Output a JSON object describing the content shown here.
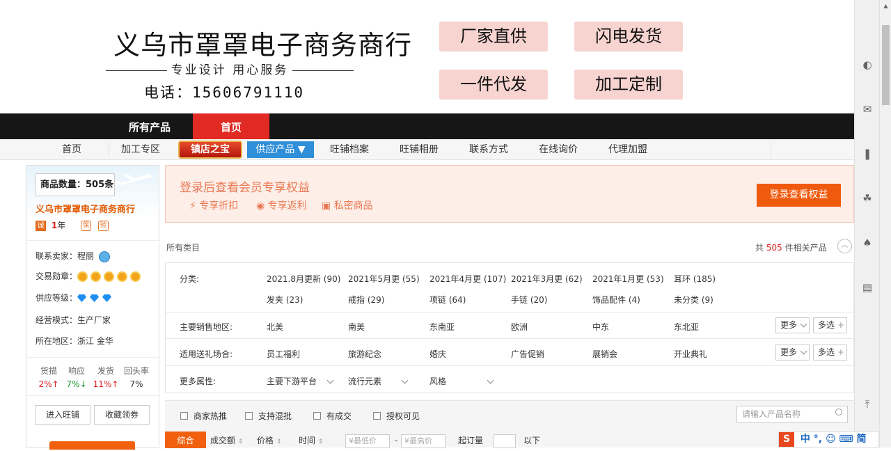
{
  "banner": {
    "shop_title": "义乌市罩罩电子商务商行",
    "slogan": "专业设计  用心服务",
    "phone": "电话：15606791110",
    "tags": [
      "厂家直供",
      "闪电发货",
      "一件代发",
      "加工定制"
    ]
  },
  "topnav": {
    "items": [
      "所有产品",
      "首页"
    ],
    "active_color": "#e02a23"
  },
  "subnav": {
    "items": [
      "首页",
      "加工专区",
      "旺铺档案",
      "旺铺相册",
      "联系方式",
      "在线询价",
      "代理加盟"
    ],
    "treasure_label": "镇店之宝",
    "supply_label": "供应产品 ▼"
  },
  "sidebar": {
    "count_label": "商品数量：505条",
    "shop_name": "义乌市罩罩电子商务商行",
    "years_num": "1",
    "years_unit": "年",
    "contact_label": "联系卖家：",
    "contact_value": "程丽",
    "medal_label": "交易勋章：",
    "supply_level_label": "供应等级：",
    "mode_label": "经营模式：",
    "mode_value": "生产厂家",
    "region_label": "所在地区：",
    "region_value": "浙江 金华",
    "stats": [
      {
        "label": "货描",
        "value": "2%↑"
      },
      {
        "label": "响应",
        "value": "7%↓"
      },
      {
        "label": "发货",
        "value": "11%↑"
      },
      {
        "label": "回头率",
        "value": "7%"
      }
    ],
    "enter_shop": "进入旺铺",
    "collect_coupon": "收藏领券"
  },
  "member": {
    "title": "登录后查看会员专享权益",
    "perks": [
      "专享折扣",
      "专享返利",
      "私密商品"
    ],
    "button": "登录查看权益"
  },
  "listing": {
    "all_categories": "所有类目",
    "total_prefix": "共",
    "total_count": "505",
    "total_suffix": "件相关产品"
  },
  "filters": {
    "category_label": "分类:",
    "categories_row1": [
      "2021.8月更新 (90)",
      "2021年5月更 (55)",
      "2021年4月更 (107)",
      "2021年3月更 (62)",
      "2021年1月更 (53)",
      "耳环 (185)"
    ],
    "categories_row2": [
      "发夹 (23)",
      "戒指 (29)",
      "项链 (64)",
      "手链 (20)",
      "饰品配件 (4)",
      "未分类 (9)"
    ],
    "region_label": "主要销售地区:",
    "regions": [
      "北美",
      "南美",
      "东南亚",
      "欧洲",
      "中东",
      "东北亚"
    ],
    "occasion_label": "适用送礼场合:",
    "occasions": [
      "员工福利",
      "旅游纪念",
      "婚庆",
      "广告促销",
      "展销会",
      "开业典礼"
    ],
    "more_attr_label": "更多属性:",
    "more_attrs": [
      "主要下游平台",
      "流行元素",
      "风格"
    ],
    "more_btn": "更多",
    "multi_btn": "多选"
  },
  "sortbar": {
    "checks": [
      "商家热推",
      "支持混批",
      "有成交",
      "授权可见"
    ],
    "search_placeholder": "请输入产品名称",
    "sorts": [
      "综合",
      "成交额",
      "价格",
      "时间"
    ],
    "min_price": "¥最低价",
    "max_price": "¥最高价",
    "moq_label": "起订量",
    "below_label": "以下"
  },
  "ime": {
    "text": "中 °, ☺ ⌨ 简"
  }
}
